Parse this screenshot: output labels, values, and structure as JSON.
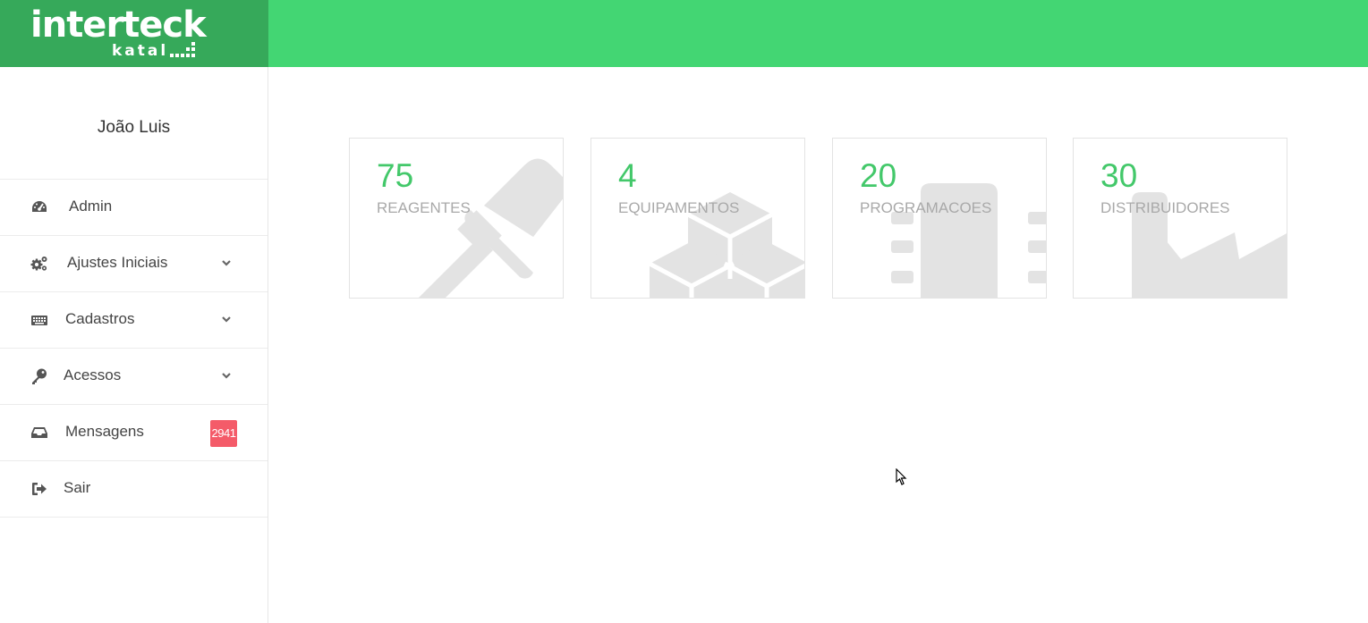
{
  "brand": {
    "name": "interteck",
    "sub": "katal"
  },
  "colors": {
    "accent": "#43d673",
    "accent_dark": "#36a95a",
    "number": "#43c86a",
    "badge": "#f45b69"
  },
  "user": {
    "name": "João Luis"
  },
  "sidebar": {
    "items": [
      {
        "label": "Admin",
        "icon": "tachometer-icon"
      },
      {
        "label": "Ajustes Iniciais",
        "icon": "gears-icon"
      },
      {
        "label": "Cadastros",
        "icon": "keyboard-icon"
      },
      {
        "label": "Acessos",
        "icon": "key-icon"
      },
      {
        "label": "Mensagens",
        "icon": "inbox-icon",
        "badge": "2941"
      },
      {
        "label": "Sair",
        "icon": "sign-out-icon"
      }
    ]
  },
  "stats": [
    {
      "value": "75",
      "label": "REAGENTES",
      "icon": "eyedropper-icon"
    },
    {
      "value": "4",
      "label": "EQUIPAMENTOS",
      "icon": "cubes-icon"
    },
    {
      "value": "20",
      "label": "PROGRAMACOES",
      "icon": "notebook-icon"
    },
    {
      "value": "30",
      "label": "DISTRIBUIDORES",
      "icon": "industry-icon"
    }
  ]
}
